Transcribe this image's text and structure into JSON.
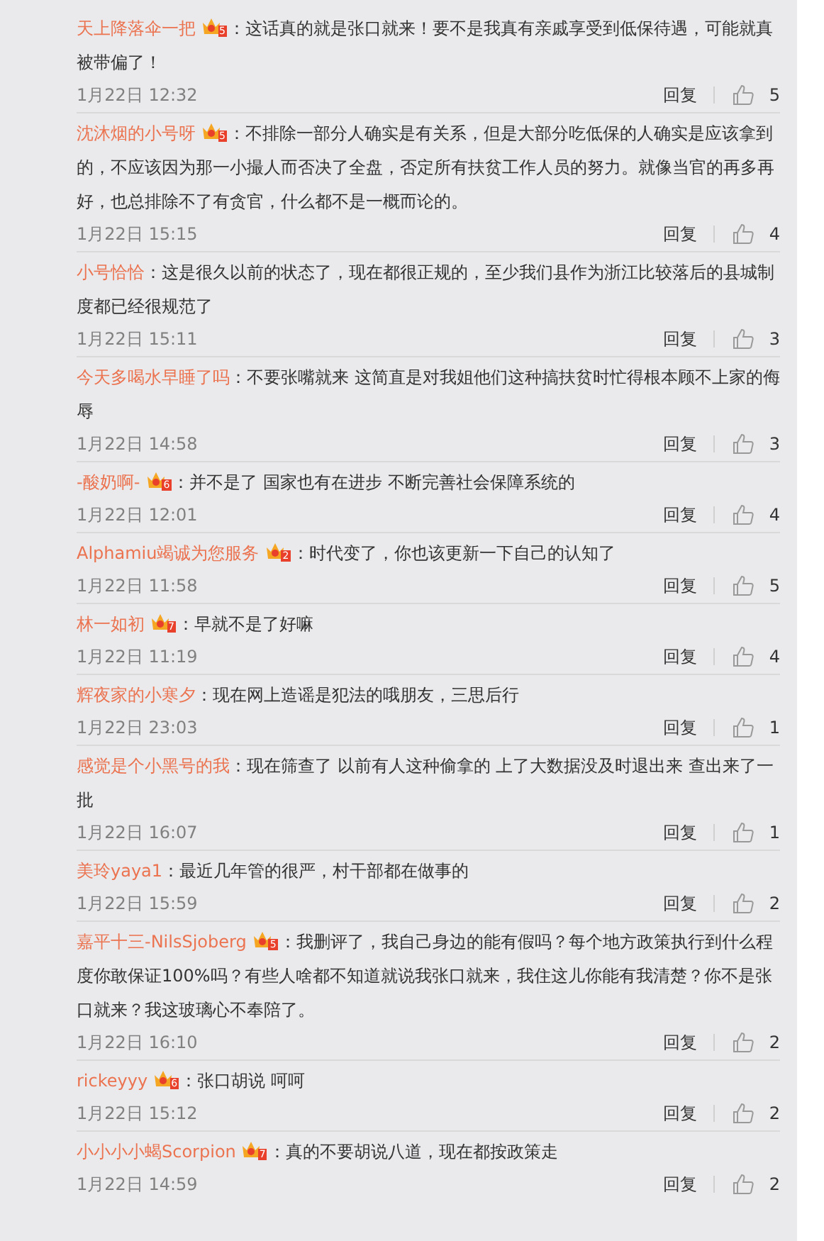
{
  "comments": [
    {
      "user": "天上降落伞一把",
      "badge": "5",
      "text": "：这话真的就是张口就来！要不是我真有亲戚享受到低保待遇，可能就真被带偏了！",
      "time": "1月22日 12:32",
      "reply": "回复",
      "likes": "5"
    },
    {
      "user": "沈沐烟的小号呀",
      "badge": "5",
      "text": "：不排除一部分人确实是有关系，但是大部分吃低保的人确实是应该拿到的，不应该因为那一小撮人而否决了全盘，否定所有扶贫工作人员的努力。就像当官的再多再好，也总排除不了有贪官，什么都不是一概而论的。",
      "time": "1月22日 15:15",
      "reply": "回复",
      "likes": "4"
    },
    {
      "user": "小号恰恰",
      "text": "：这是很久以前的状态了，现在都很正规的，至少我们县作为浙江比较落后的县城制度都已经很规范了",
      "time": "1月22日 15:11",
      "reply": "回复",
      "likes": "3"
    },
    {
      "user": "今天多喝水早睡了吗",
      "text": "：不要张嘴就来  这简直是对我姐他们这种搞扶贫时忙得根本顾不上家的侮辱",
      "time": "1月22日 14:58",
      "reply": "回复",
      "likes": "3"
    },
    {
      "user": "-酸奶啊-",
      "badge": "6",
      "text": "：并不是了 国家也有在进步 不断完善社会保障系统的",
      "time": "1月22日 12:01",
      "reply": "回复",
      "likes": "4"
    },
    {
      "user": "Alphamiu竭诚为您服务",
      "badge": "2",
      "text": "：时代变了，你也该更新一下自己的认知了",
      "time": "1月22日 11:58",
      "reply": "回复",
      "likes": "5"
    },
    {
      "user": "林一如初",
      "badge": "7",
      "text": "：早就不是了好嘛",
      "time": "1月22日 11:19",
      "reply": "回复",
      "likes": "4"
    },
    {
      "user": "辉夜家的小寒夕",
      "text": "：现在网上造谣是犯法的哦朋友，三思后行",
      "time": "1月22日 23:03",
      "reply": "回复",
      "likes": "1"
    },
    {
      "user": "感觉是个小黑号的我",
      "text": "：现在筛查了 以前有人这种偷拿的 上了大数据没及时退出来  查出来了一批",
      "time": "1月22日 16:07",
      "reply": "回复",
      "likes": "1"
    },
    {
      "user": "美玲yaya1",
      "text": "：最近几年管的很严，村干部都在做事的",
      "time": "1月22日 15:59",
      "reply": "回复",
      "likes": "2"
    },
    {
      "user": "嘉平十三-NilsSjoberg",
      "badge": "5",
      "text": "：我删评了，我自己身边的能有假吗？每个地方政策执行到什么程度你敢保证100%吗？有些人啥都不知道就说我张口就来，我住这儿你能有我清楚？你不是张口就来？我这玻璃心不奉陪了。",
      "time": "1月22日 16:10",
      "reply": "回复",
      "likes": "2"
    },
    {
      "user": "rickeyyy",
      "badge": "6",
      "text": "：张口胡说 呵呵",
      "time": "1月22日 15:12",
      "reply": "回复",
      "likes": "2"
    },
    {
      "user": "小小小小蝎Scorpion",
      "badge": "7",
      "text": "：真的不要胡说八道，现在都按政策走",
      "time": "1月22日 14:59",
      "reply": "回复",
      "likes": "2"
    }
  ]
}
